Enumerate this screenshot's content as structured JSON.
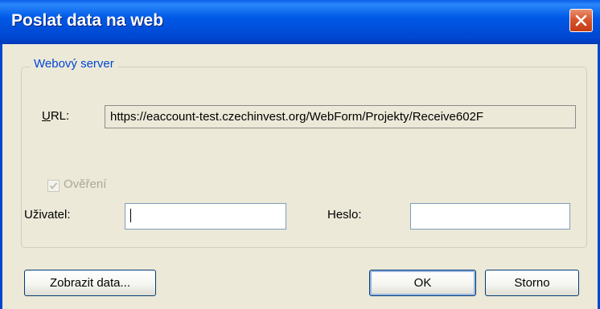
{
  "window": {
    "title": "Poslat data na web"
  },
  "group": {
    "title": "Webový server"
  },
  "url": {
    "label_accesskey": "U",
    "label_rest": "RL:",
    "value": "https://eaccount-test.czechinvest.org/WebForm/Projekty/Receive602F"
  },
  "auth": {
    "label": "Ověření",
    "checked": true,
    "enabled": false
  },
  "user": {
    "label": "Uživatel:",
    "value": ""
  },
  "password": {
    "label": "Heslo:",
    "value": ""
  },
  "buttons": {
    "show_data": "Zobrazit data...",
    "ok": "OK",
    "cancel": "Storno"
  }
}
